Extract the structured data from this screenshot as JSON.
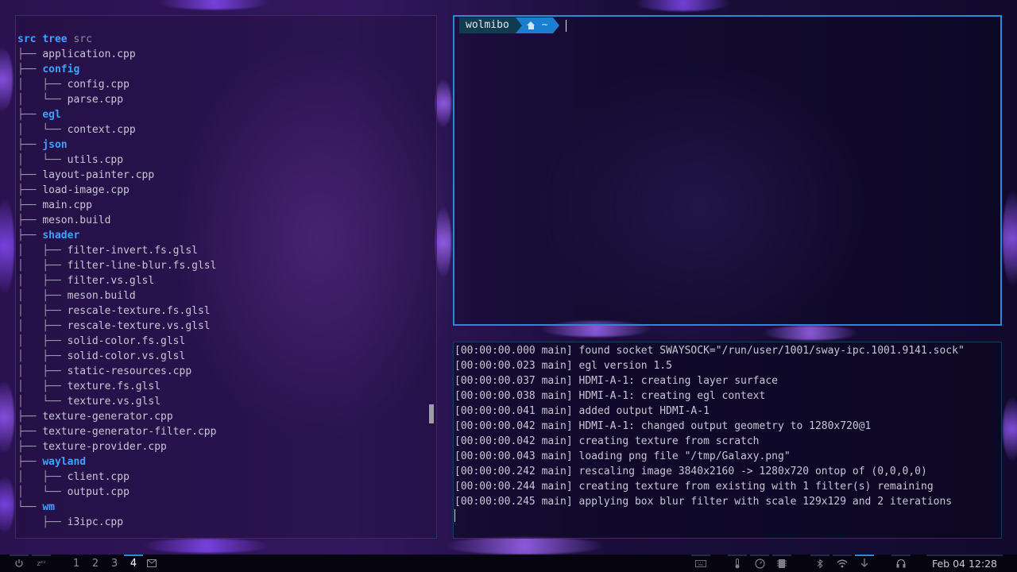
{
  "tree": {
    "command": "tree",
    "argument": "src",
    "lines": [
      {
        "guide": "",
        "name": "src",
        "type": "dir"
      },
      {
        "guide": "├── ",
        "name": "application.cpp",
        "type": "file"
      },
      {
        "guide": "├── ",
        "name": "config",
        "type": "dir"
      },
      {
        "guide": "│   ├── ",
        "name": "config.cpp",
        "type": "file"
      },
      {
        "guide": "│   └── ",
        "name": "parse.cpp",
        "type": "file"
      },
      {
        "guide": "├── ",
        "name": "egl",
        "type": "dir"
      },
      {
        "guide": "│   └── ",
        "name": "context.cpp",
        "type": "file"
      },
      {
        "guide": "├── ",
        "name": "json",
        "type": "dir"
      },
      {
        "guide": "│   └── ",
        "name": "utils.cpp",
        "type": "file"
      },
      {
        "guide": "├── ",
        "name": "layout-painter.cpp",
        "type": "file"
      },
      {
        "guide": "├── ",
        "name": "load-image.cpp",
        "type": "file"
      },
      {
        "guide": "├── ",
        "name": "main.cpp",
        "type": "file"
      },
      {
        "guide": "├── ",
        "name": "meson.build",
        "type": "file"
      },
      {
        "guide": "├── ",
        "name": "shader",
        "type": "dir"
      },
      {
        "guide": "│   ├── ",
        "name": "filter-invert.fs.glsl",
        "type": "file"
      },
      {
        "guide": "│   ├── ",
        "name": "filter-line-blur.fs.glsl",
        "type": "file"
      },
      {
        "guide": "│   ├── ",
        "name": "filter.vs.glsl",
        "type": "file"
      },
      {
        "guide": "│   ├── ",
        "name": "meson.build",
        "type": "file"
      },
      {
        "guide": "│   ├── ",
        "name": "rescale-texture.fs.glsl",
        "type": "file"
      },
      {
        "guide": "│   ├── ",
        "name": "rescale-texture.vs.glsl",
        "type": "file"
      },
      {
        "guide": "│   ├── ",
        "name": "solid-color.fs.glsl",
        "type": "file"
      },
      {
        "guide": "│   ├── ",
        "name": "solid-color.vs.glsl",
        "type": "file"
      },
      {
        "guide": "│   ├── ",
        "name": "static-resources.cpp",
        "type": "file"
      },
      {
        "guide": "│   ├── ",
        "name": "texture.fs.glsl",
        "type": "file"
      },
      {
        "guide": "│   └── ",
        "name": "texture.vs.glsl",
        "type": "file"
      },
      {
        "guide": "├── ",
        "name": "texture-generator.cpp",
        "type": "file"
      },
      {
        "guide": "├── ",
        "name": "texture-generator-filter.cpp",
        "type": "file"
      },
      {
        "guide": "├── ",
        "name": "texture-provider.cpp",
        "type": "file"
      },
      {
        "guide": "├── ",
        "name": "wayland",
        "type": "dir"
      },
      {
        "guide": "│   ├── ",
        "name": "client.cpp",
        "type": "file"
      },
      {
        "guide": "│   └── ",
        "name": "output.cpp",
        "type": "file"
      },
      {
        "guide": "└── ",
        "name": "wm",
        "type": "dir"
      },
      {
        "guide": "    ├── ",
        "name": "i3ipc.cpp",
        "type": "file"
      }
    ]
  },
  "terminal": {
    "user": "wolmibo",
    "path": "~",
    "icon": "home-icon"
  },
  "log": {
    "lines": [
      "[00:00:00.000 main] found socket SWAYSOCK=\"/run/user/1001/sway-ipc.1001.9141.sock\"",
      "[00:00:00.023 main] egl version 1.5",
      "[00:00:00.037 main] HDMI-A-1: creating layer surface",
      "[00:00:00.038 main] HDMI-A-1: creating egl context",
      "[00:00:00.041 main] added output HDMI-A-1",
      "[00:00:00.042 main] HDMI-A-1: changed output geometry to 1280x720@1",
      "[00:00:00.042 main] creating texture from scratch",
      "[00:00:00.043 main] loading png file \"/tmp/Galaxy.png\"",
      "[00:00:00.242 main] rescaling image 3840x2160 -> 1280x720 ontop of (0,0,0,0)",
      "[00:00:00.244 main] creating texture from existing with 1 filter(s) remaining",
      "[00:00:00.245 main] applying box blur filter with scale 129x129 and 2 iterations"
    ]
  },
  "taskbar": {
    "power_icon": "power-icon",
    "sleep_label": "zᶻᶻ",
    "workspaces": [
      "1",
      "2",
      "3",
      "4"
    ],
    "active_workspace": "4",
    "mail_icon": "mail-icon",
    "tray_icons": [
      "keyboard-icon",
      "thermometer-icon",
      "gauge-icon",
      "memory-icon",
      "bluetooth-icon",
      "wifi-icon",
      "download-icon",
      "headphones-icon"
    ],
    "clock": "Feb 04 12:28"
  },
  "colors": {
    "accent": "#2b8ad6",
    "directory": "#3fa2ff",
    "prompt_user_bg": "#113b4f",
    "prompt_path_bg": "#1a7fd0"
  }
}
